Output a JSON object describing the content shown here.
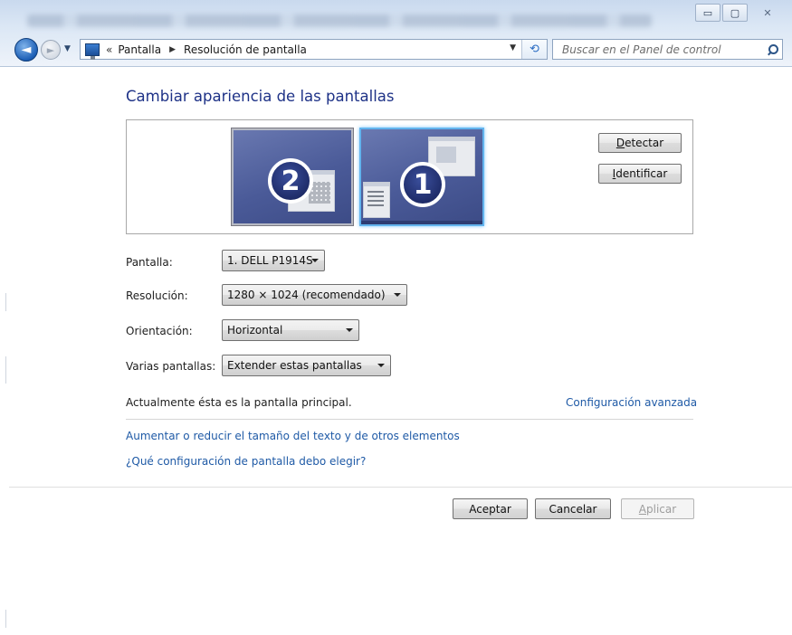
{
  "window": {
    "controls": {
      "minimize": "▭",
      "maximize": "▢",
      "close": "✕"
    }
  },
  "nav": {
    "back_icon": "◄",
    "forward_icon": "►",
    "dropdown_icon": "▼"
  },
  "address_bar": {
    "chevron": "«",
    "crumbs": [
      "Pantalla",
      "Resolución de pantalla"
    ],
    "separator": "▶",
    "dropdown_icon": "▼",
    "refresh_icon": "⟲"
  },
  "search": {
    "placeholder": "Buscar en el Panel de control"
  },
  "main": {
    "title": "Cambiar apariencia de las pantallas",
    "monitors": [
      {
        "number": "2",
        "selected": false
      },
      {
        "number": "1",
        "selected": true
      }
    ],
    "detect_button": {
      "mnemonic": "D",
      "rest": "etectar"
    },
    "identify_button": {
      "mnemonic": "I",
      "rest": "dentificar"
    },
    "fields": {
      "display": {
        "label": "Pantalla:",
        "value": "1. DELL P1914S"
      },
      "resolution": {
        "label": "Resolución:",
        "value": "1280 × 1024 (recomendado)"
      },
      "orientation": {
        "label": "Orientación:",
        "value": "Horizontal"
      },
      "multiple": {
        "label": "Varias pantallas:",
        "value": "Extender estas pantallas"
      }
    },
    "status": "Actualmente ésta es la pantalla principal.",
    "advanced_link": "Configuración avanzada",
    "links": [
      "Aumentar o reducir el tamaño del texto y de otros elementos",
      "¿Qué configuración de pantalla debo elegir?"
    ]
  },
  "footer": {
    "accept": "Aceptar",
    "cancel": "Cancelar",
    "apply": {
      "mnemonic": "A",
      "rest": "plicar"
    }
  },
  "colors": {
    "title_text": "#1e3287",
    "link": "#1f5aa6",
    "selected_monitor_border": "#62b4ee",
    "disabled_text": "#9d9d9d"
  }
}
